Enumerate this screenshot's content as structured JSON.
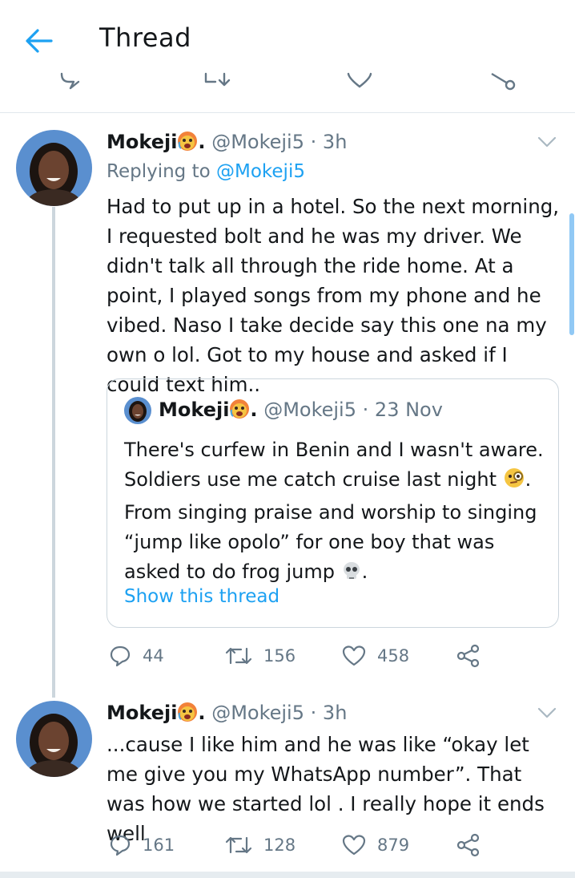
{
  "header": {
    "title": "Thread"
  },
  "tweets": [
    {
      "name": "Mokeji",
      "handle": "@Mokeji5",
      "dot": "·",
      "time": "3h",
      "replying_label": "Replying to",
      "replying_to": "@Mokeji5",
      "text": "Had to put up in a hotel. So the next morning, I requested bolt and he was my driver. We didn't talk all through the ride home. At a point, I played songs from my phone and he vibed. Naso I take decide say this one na my own o lol. Got to my house and asked if I could text him..",
      "quote": {
        "name": "Mokeji",
        "handle": "@Mokeji5",
        "dot": "·",
        "time": "23 Nov",
        "text_line1": "There's curfew in Benin and I wasn't aware.",
        "text_line2": "Soldiers use me catch cruise last night",
        "text_line2_end": ".",
        "text_line3": "From singing praise and worship to singing",
        "text_line4": "“jump like opolo” for one boy that was",
        "text_line5": "asked to do frog jump",
        "text_line5_end": ".",
        "link": "Show this thread"
      },
      "replies": "44",
      "retweets": "156",
      "likes": "458"
    },
    {
      "name": "Mokeji",
      "handle": "@Mokeji5",
      "dot": "·",
      "time": "3h",
      "text": "...cause I like him and he was like “okay let me give you my WhatsApp number”. That was how we started lol . I really hope it ends well",
      "replies": "161",
      "retweets": "128",
      "likes": "879"
    }
  ],
  "colors": {
    "accent": "#1da1f2",
    "secondary_text": "#657786",
    "border": "#ccd6dd"
  }
}
